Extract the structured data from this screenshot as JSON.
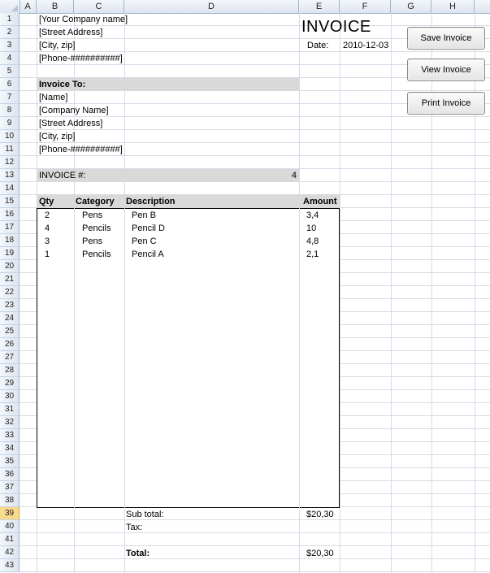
{
  "columns": [
    "A",
    "B",
    "C",
    "D",
    "E",
    "F",
    "G",
    "H"
  ],
  "rows": [
    "1",
    "2",
    "3",
    "4",
    "5",
    "6",
    "7",
    "8",
    "9",
    "10",
    "11",
    "12",
    "13",
    "14",
    "15",
    "16",
    "17",
    "18",
    "19",
    "20",
    "21",
    "22",
    "23",
    "24",
    "25",
    "26",
    "27",
    "28",
    "29",
    "30",
    "31",
    "32",
    "33",
    "34",
    "35",
    "36",
    "37",
    "38",
    "39",
    "40",
    "41",
    "42",
    "43"
  ],
  "header": {
    "company": "[Your Company name]",
    "street": "[Street Address]",
    "city": "[City, zip]",
    "phone": "[Phone-##########]",
    "title": "INVOICE",
    "date_label": "Date:",
    "date_value": "2010-12-03"
  },
  "bill_to": {
    "heading": "Invoice To:",
    "name": "[Name]",
    "company": "[Company Name]",
    "street": "[Street Address]",
    "city": "[City, zip]",
    "phone": "[Phone-##########]"
  },
  "invoice_number": {
    "label": "INVOICE #:",
    "value": "4"
  },
  "table": {
    "headers": {
      "qty": "Qty",
      "category": "Category",
      "description": "Description",
      "amount": "Amount"
    },
    "items": [
      {
        "qty": "2",
        "category": "Pens",
        "description": "Pen B",
        "amount": "3,4"
      },
      {
        "qty": "4",
        "category": "Pencils",
        "description": "Pencil D",
        "amount": "10"
      },
      {
        "qty": "3",
        "category": "Pens",
        "description": "Pen C",
        "amount": "4,8"
      },
      {
        "qty": "1",
        "category": "Pencils",
        "description": "Pencil A",
        "amount": "2,1"
      }
    ]
  },
  "totals": {
    "subtotal_label": "Sub total:",
    "subtotal_value": "$20,30",
    "tax_label": "Tax:",
    "total_label": "Total:",
    "total_value": "$20,30"
  },
  "buttons": {
    "save": "Save Invoice",
    "view": "View Invoice",
    "print": "Print Invoice"
  },
  "selected_row": "39",
  "colors": {
    "header_fill": "#d9d9d9",
    "grid": "#d4dce6",
    "selected_row_header": "#f9d98d"
  }
}
